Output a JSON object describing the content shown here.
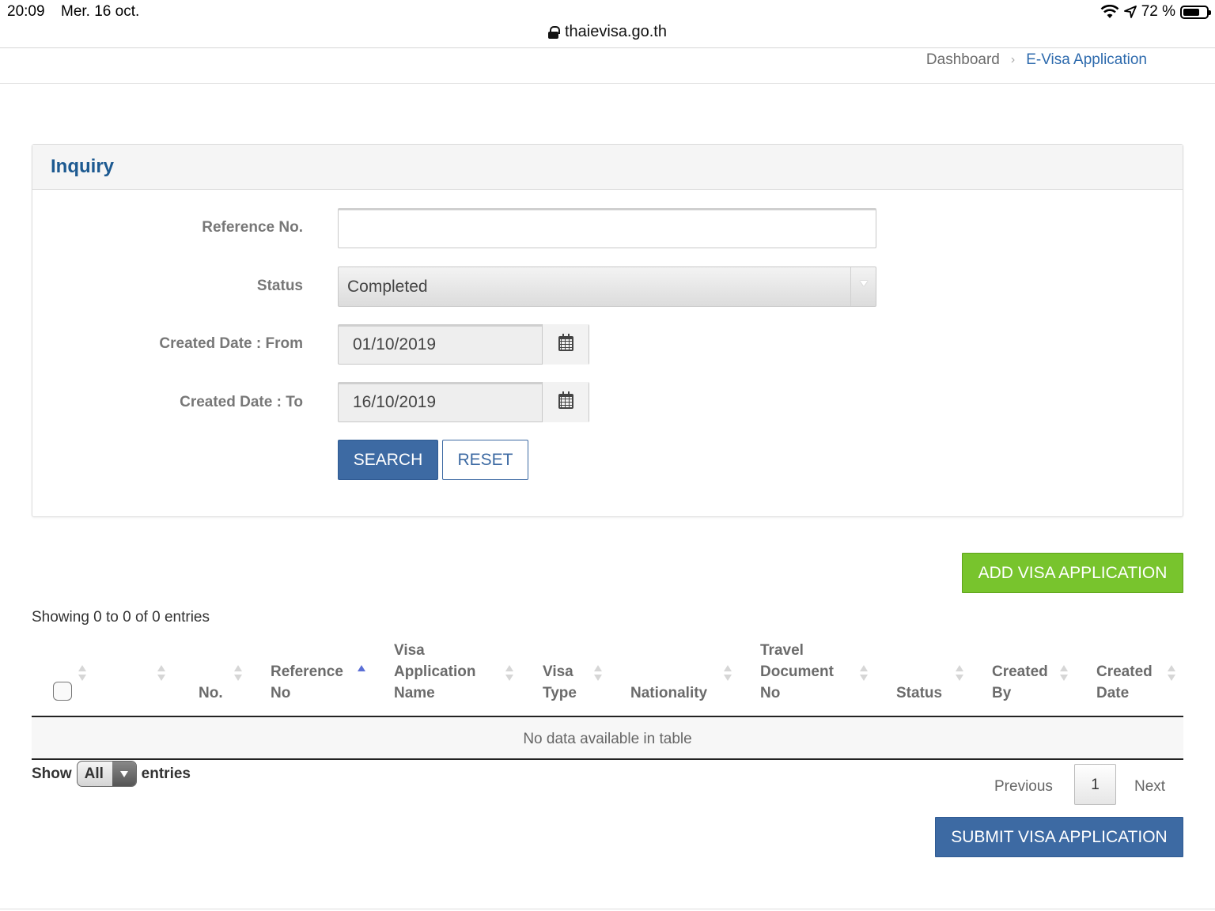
{
  "status_bar": {
    "time": "20:09",
    "date": "Mer. 16 oct.",
    "battery": "72 %",
    "battery_level": 0.72
  },
  "browser": {
    "url": "thaievisa.go.th"
  },
  "page": {
    "heading_cut": "..."
  },
  "breadcrumb": {
    "home": "Dashboard",
    "separator": "›",
    "current": "E-Visa Application"
  },
  "inquiry": {
    "title": "Inquiry",
    "reference_label": "Reference No.",
    "reference_value": "",
    "status_label": "Status",
    "status_value": "Completed",
    "date_from_label": "Created Date : From",
    "date_from_value": "01/10/2019",
    "date_to_label": "Created Date : To",
    "date_to_value": "16/10/2019",
    "search_label": "SEARCH",
    "reset_label": "RESET"
  },
  "actions": {
    "add_label": "ADD VISA APPLICATION",
    "submit_label": "SUBMIT VISA APPLICATION"
  },
  "table": {
    "info": "Showing 0 to 0 of 0 entries",
    "columns": {
      "no": "No.",
      "reference_no": [
        "Reference",
        "No"
      ],
      "visa_name": [
        "Visa",
        "Application",
        "Name"
      ],
      "visa_type": [
        "Visa",
        "Type"
      ],
      "nationality": "Nationality",
      "travel_doc": [
        "Travel",
        "Document",
        "No"
      ],
      "status": "Status",
      "created_by": [
        "Created",
        "By"
      ],
      "created_date": [
        "Created",
        "Date"
      ]
    },
    "empty_message": "No data available in table",
    "length_show": "Show",
    "length_value": "All",
    "length_entries": "entries",
    "pagination": {
      "previous": "Previous",
      "current": "1",
      "next": "Next"
    }
  },
  "colors": {
    "primary": "#3d6aa3",
    "success": "#78c42d",
    "title": "#1d5a91",
    "link": "#2d6aad"
  }
}
